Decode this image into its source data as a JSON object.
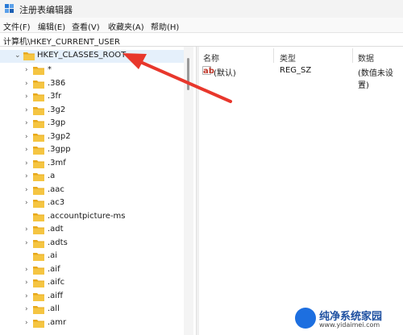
{
  "window": {
    "title": "注册表编辑器"
  },
  "menu": [
    "文件(F)",
    "编辑(E)",
    "查看(V)",
    "收藏夹(A)",
    "帮助(H)"
  ],
  "address": "计算机\\HKEY_CURRENT_USER",
  "tree": {
    "root": "HKEY_CLASSES_ROOT",
    "items": [
      "*",
      ".386",
      ".3fr",
      ".3g2",
      ".3gp",
      ".3gp2",
      ".3gpp",
      ".3mf",
      ".a",
      ".aac",
      ".ac3",
      ".accountpicture-ms",
      ".adt",
      ".adts",
      ".ai",
      ".aif",
      ".aifc",
      ".aiff",
      ".all",
      ".amr"
    ],
    "expandable": [
      true,
      true,
      true,
      true,
      true,
      true,
      true,
      true,
      true,
      true,
      true,
      false,
      true,
      true,
      false,
      true,
      true,
      true,
      true,
      true
    ]
  },
  "list": {
    "columns": [
      "名称",
      "类型",
      "数据"
    ],
    "rows": [
      {
        "name": "(默认)",
        "type": "REG_SZ",
        "data": "(数值未设置)"
      }
    ],
    "value_icon": "ab"
  },
  "watermark": {
    "name": "纯净系统家园",
    "url": "www.yidaimei.com"
  },
  "colors": {
    "folder": "#f5c542",
    "folder_dark": "#e8a91c",
    "arrow": "#e8372c"
  },
  "icons": {
    "app": "registry-editor-icon",
    "folder": "folder-icon",
    "chevron": "chevron-right-icon",
    "expanded": "chevron-down-icon"
  }
}
